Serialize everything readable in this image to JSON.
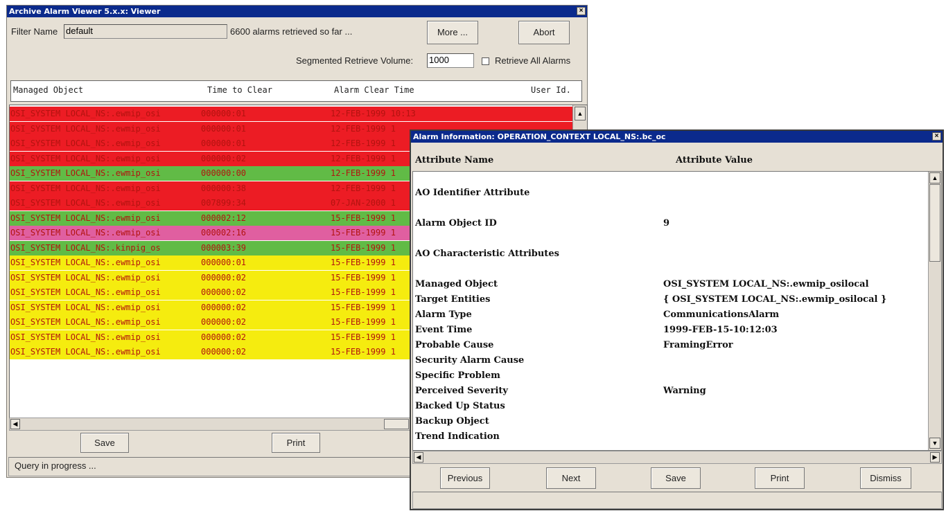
{
  "viewer": {
    "title": "Archive Alarm Viewer 5.x.x: Viewer",
    "filter_label": "Filter Name",
    "filter_value": "default",
    "retrieved_text": "6600  alarms retrieved so far ...",
    "more_label": "More ...",
    "abort_label": "Abort",
    "segmented_label": "Segmented Retrieve Volume:",
    "segmented_value": "1000",
    "retrieve_all_label": "Retrieve All Alarms",
    "columns": [
      "Managed Object",
      "Time to Clear",
      "Alarm Clear Time",
      "User Id."
    ],
    "rows": [
      {
        "object": "OSI_SYSTEM LOCAL_NS:.ewmip_osi",
        "time": "000000:01",
        "clear": "12-FEB-1999 10:13",
        "color": "#ec1c24"
      },
      {
        "object": "OSI_SYSTEM LOCAL_NS:.ewmip_osi",
        "time": "000000:01",
        "clear": "12-FEB-1999 1",
        "color": "#ec1c24"
      },
      {
        "object": "OSI_SYSTEM LOCAL_NS:.ewmip_osi",
        "time": "000000:01",
        "clear": "12-FEB-1999 1",
        "color": "#ec1c24"
      },
      {
        "object": "OSI_SYSTEM LOCAL_NS:.ewmip_osi",
        "time": "000000:02",
        "clear": "12-FEB-1999 1",
        "color": "#ec1c24"
      },
      {
        "object": "OSI_SYSTEM LOCAL_NS:.ewmip_osi",
        "time": "000000:00",
        "clear": "12-FEB-1999 1",
        "color": "#61bb46"
      },
      {
        "object": "OSI_SYSTEM LOCAL_NS:.ewmip_osi",
        "time": "000000:38",
        "clear": "12-FEB-1999 1",
        "color": "#ec1c24"
      },
      {
        "object": "OSI_SYSTEM LOCAL_NS:.ewmip_osi",
        "time": "007899:34",
        "clear": "07-JAN-2000 1",
        "color": "#ec1c24"
      },
      {
        "object": "OSI_SYSTEM LOCAL_NS:.ewmip_osi",
        "time": "000002:12",
        "clear": "15-FEB-1999 1",
        "color": "#61bb46"
      },
      {
        "object": "OSI_SYSTEM LOCAL_NS:.ewmip_osi",
        "time": "000002:16",
        "clear": "15-FEB-1999 1",
        "color": "#e05fa0"
      },
      {
        "object": "OSI_SYSTEM LOCAL_NS:.kinpig_os",
        "time": "000003:39",
        "clear": "15-FEB-1999 1",
        "color": "#61bb46"
      },
      {
        "object": "OSI_SYSTEM LOCAL_NS:.ewmip_osi",
        "time": "000000:01",
        "clear": "15-FEB-1999 1",
        "color": "#f5ec0f"
      },
      {
        "object": "OSI_SYSTEM LOCAL_NS:.ewmip_osi",
        "time": "000000:02",
        "clear": "15-FEB-1999 1",
        "color": "#f5ec0f"
      },
      {
        "object": "OSI_SYSTEM LOCAL_NS:.ewmip_osi",
        "time": "000000:02",
        "clear": "15-FEB-1999 1",
        "color": "#f5ec0f"
      },
      {
        "object": "OSI_SYSTEM LOCAL_NS:.ewmip_osi",
        "time": "000000:02",
        "clear": "15-FEB-1999 1",
        "color": "#f5ec0f"
      },
      {
        "object": "OSI_SYSTEM LOCAL_NS:.ewmip_osi",
        "time": "000000:02",
        "clear": "15-FEB-1999 1",
        "color": "#f5ec0f"
      },
      {
        "object": "OSI_SYSTEM LOCAL_NS:.ewmip_osi",
        "time": "000000:02",
        "clear": "15-FEB-1999 1",
        "color": "#f5ec0f"
      },
      {
        "object": "OSI_SYSTEM LOCAL_NS:.ewmip_osi",
        "time": "000000:02",
        "clear": "15-FEB-1999 1",
        "color": "#f5ec0f"
      }
    ],
    "save_label": "Save",
    "print_label": "Print",
    "status": "Query in progress ..."
  },
  "info": {
    "title": "Alarm Information: OPERATION_CONTEXT LOCAL_NS:.bc_oc",
    "col_name": "Attribute Name",
    "col_value": "Attribute Value",
    "attributes": [
      {
        "name": "AO Identifier Attribute",
        "value": ""
      },
      {
        "name": "Alarm Object ID",
        "value": "9"
      },
      {
        "name": "AO Characteristic Attributes",
        "value": ""
      },
      {
        "name": "Managed Object",
        "value": "OSI_SYSTEM LOCAL_NS:.ewmip_osilocal"
      },
      {
        "name": "Target Entities",
        "value": "{ OSI_SYSTEM LOCAL_NS:.ewmip_osilocal }"
      },
      {
        "name": "Alarm Type",
        "value": "CommunicationsAlarm"
      },
      {
        "name": "Event Time",
        "value": "1999-FEB-15-10:12:03"
      },
      {
        "name": "Probable Cause",
        "value": "FramingError"
      },
      {
        "name": "Security Alarm Cause",
        "value": ""
      },
      {
        "name": "Specific Problem",
        "value": ""
      },
      {
        "name": "Perceived Severity",
        "value": "Warning"
      },
      {
        "name": "Backed Up Status",
        "value": ""
      },
      {
        "name": "Backup Object",
        "value": ""
      },
      {
        "name": "Trend Indication",
        "value": ""
      }
    ],
    "previous_label": "Previous",
    "next_label": "Next",
    "save_label": "Save",
    "print_label": "Print",
    "dismiss_label": "Dismiss"
  },
  "icons": {
    "close": "close-icon",
    "scroll_up": "arrow-up-icon",
    "scroll_down": "arrow-down-icon",
    "scroll_left": "arrow-left-icon",
    "scroll_right": "arrow-right-icon"
  }
}
